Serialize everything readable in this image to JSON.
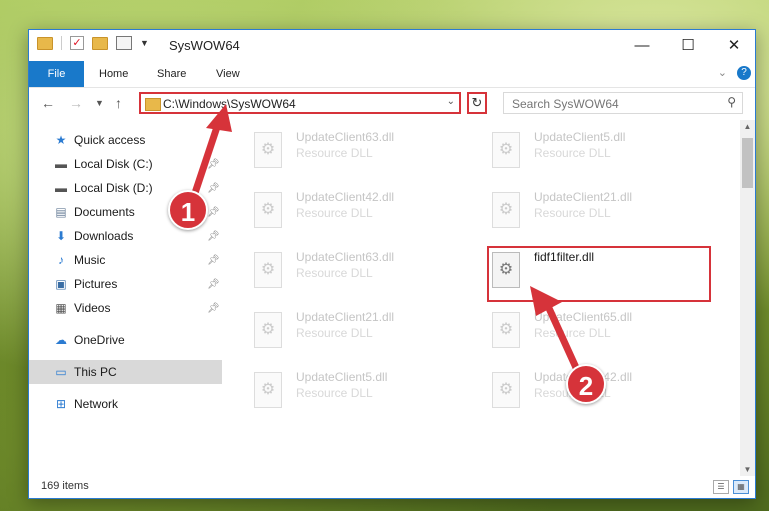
{
  "window": {
    "title": "SysWOW64"
  },
  "ribbon": {
    "tabs": [
      "File",
      "Home",
      "Share",
      "View"
    ]
  },
  "address": {
    "path": "C:\\Windows\\SysWOW64"
  },
  "search": {
    "placeholder": "Search SysWOW64"
  },
  "sidebar": {
    "items": [
      {
        "label": "Quick access",
        "icon": "star-icon"
      },
      {
        "label": "Local Disk (C:)",
        "icon": "drive-icon"
      },
      {
        "label": "Local Disk (D:)",
        "icon": "drive-icon"
      },
      {
        "label": "Documents",
        "icon": "documents-icon"
      },
      {
        "label": "Downloads",
        "icon": "download-arrow-icon"
      },
      {
        "label": "Music",
        "icon": "music-note-icon"
      },
      {
        "label": "Pictures",
        "icon": "pictures-icon"
      },
      {
        "label": "Videos",
        "icon": "videos-icon"
      },
      {
        "label": "OneDrive",
        "icon": "cloud-icon"
      },
      {
        "label": "This PC",
        "icon": "monitor-icon"
      },
      {
        "label": "Network",
        "icon": "network-icon"
      }
    ]
  },
  "files": [
    {
      "name": "UpdateClient63.dll",
      "type": "Resource DLL"
    },
    {
      "name": "UpdateClient5.dll",
      "type": "Resource DLL"
    },
    {
      "name": "UpdateClient42.dll",
      "type": "Resource DLL"
    },
    {
      "name": "UpdateClient21.dll",
      "type": "Resource DLL"
    },
    {
      "name": "UpdateClient63.dll",
      "type": "Resource DLL"
    },
    {
      "name": "fidf1filter.dll",
      "type": ""
    },
    {
      "name": "UpdateClient21.dll",
      "type": "Resource DLL"
    },
    {
      "name": "UpdateClient65.dll",
      "type": "Resource DLL"
    },
    {
      "name": "UpdateClient5.dll",
      "type": "Resource DLL"
    },
    {
      "name": "UpdateClient42.dll",
      "type": "Resource DLL"
    }
  ],
  "status": {
    "item_count": "169 items"
  },
  "annotations": {
    "badge1": "1",
    "badge2": "2",
    "color": "#d6333a"
  }
}
